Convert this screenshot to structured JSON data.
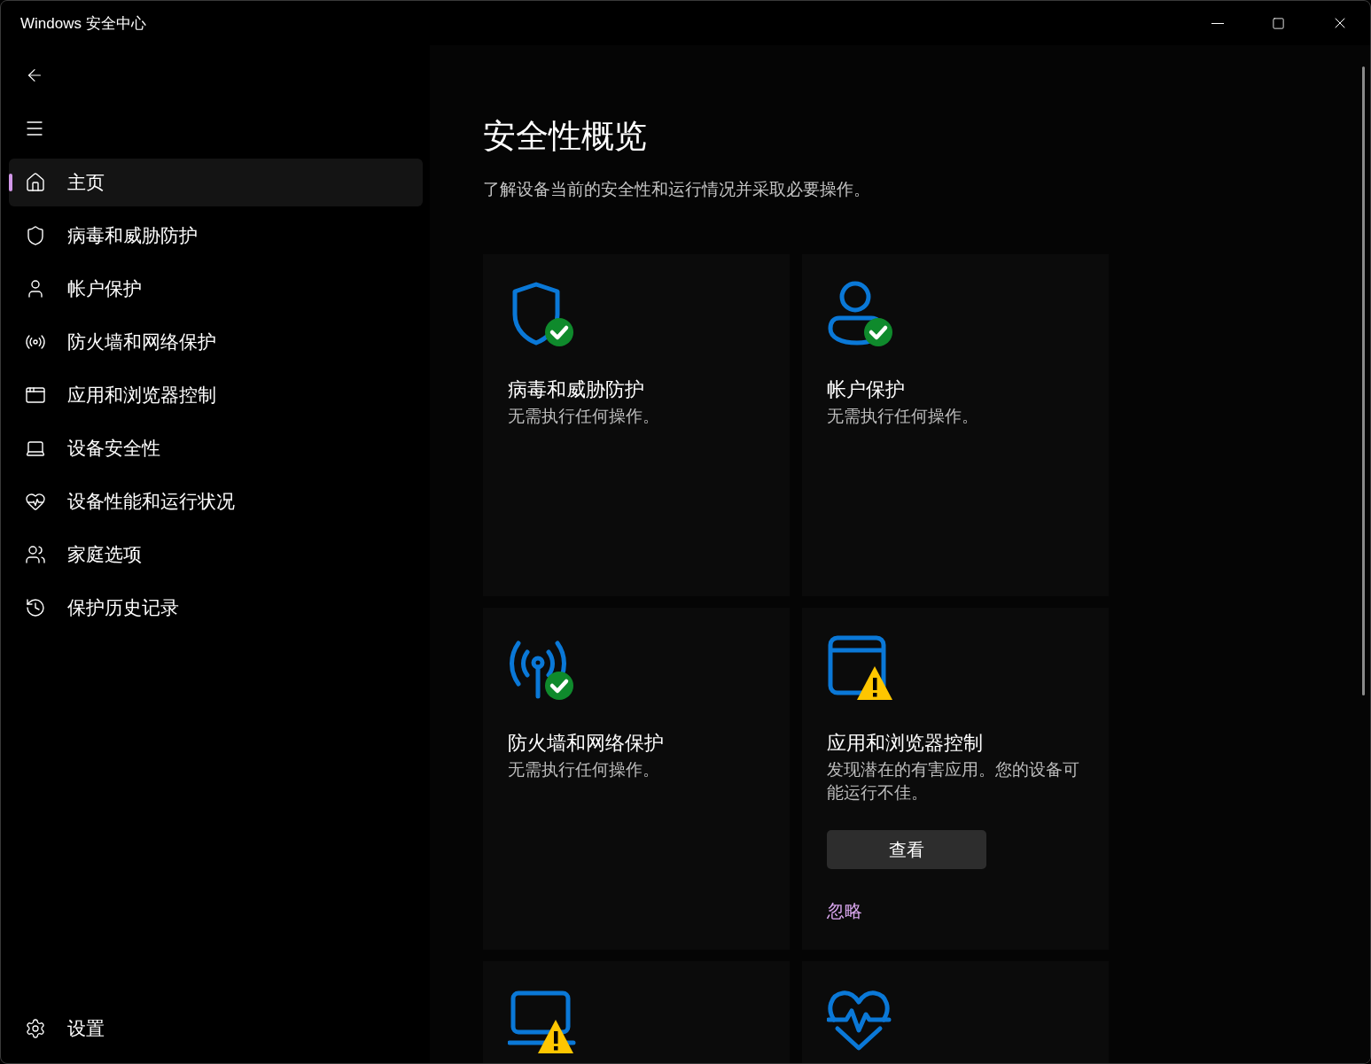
{
  "window": {
    "title": "Windows 安全中心"
  },
  "sidebar": {
    "items": [
      {
        "label": "主页",
        "selected": true
      },
      {
        "label": "病毒和威胁防护",
        "selected": false
      },
      {
        "label": "帐户保护",
        "selected": false
      },
      {
        "label": "防火墙和网络保护",
        "selected": false
      },
      {
        "label": "应用和浏览器控制",
        "selected": false
      },
      {
        "label": "设备安全性",
        "selected": false
      },
      {
        "label": "设备性能和运行状况",
        "selected": false
      },
      {
        "label": "家庭选项",
        "selected": false
      },
      {
        "label": "保护历史记录",
        "selected": false
      }
    ],
    "footer": {
      "label": "设置"
    }
  },
  "page": {
    "title": "安全性概览",
    "subtitle": "了解设备当前的安全性和运行情况并采取必要操作。"
  },
  "cards": [
    {
      "kind": "ok",
      "title": "病毒和威胁防护",
      "description": "无需执行任何操作。"
    },
    {
      "kind": "ok",
      "title": "帐户保护",
      "description": "无需执行任何操作。"
    },
    {
      "kind": "ok",
      "title": "防火墙和网络保护",
      "description": "无需执行任何操作。"
    },
    {
      "kind": "warning",
      "title": "应用和浏览器控制",
      "description": "发现潜在的有害应用。您的设备可能运行不佳。",
      "button": "查看",
      "link": "忽略"
    },
    {
      "kind": "warning"
    },
    {
      "kind": "plain"
    }
  ]
}
